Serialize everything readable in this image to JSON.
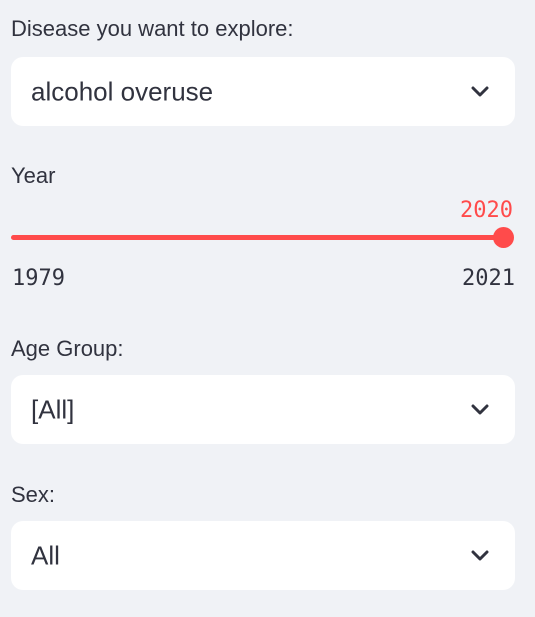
{
  "disease": {
    "label": "Disease you want to explore:",
    "value": "alcohol overuse"
  },
  "year": {
    "label": "Year",
    "value": "2020",
    "min": "1979",
    "max": "2021"
  },
  "age_group": {
    "label": "Age Group:",
    "value": "[All]"
  },
  "sex": {
    "label": "Sex:",
    "value": "All"
  },
  "colors": {
    "background": "#f0f2f6",
    "accent": "#ff4b4b",
    "text": "#31333f",
    "field": "#ffffff"
  },
  "icons": [
    "chevron-down-icon"
  ]
}
